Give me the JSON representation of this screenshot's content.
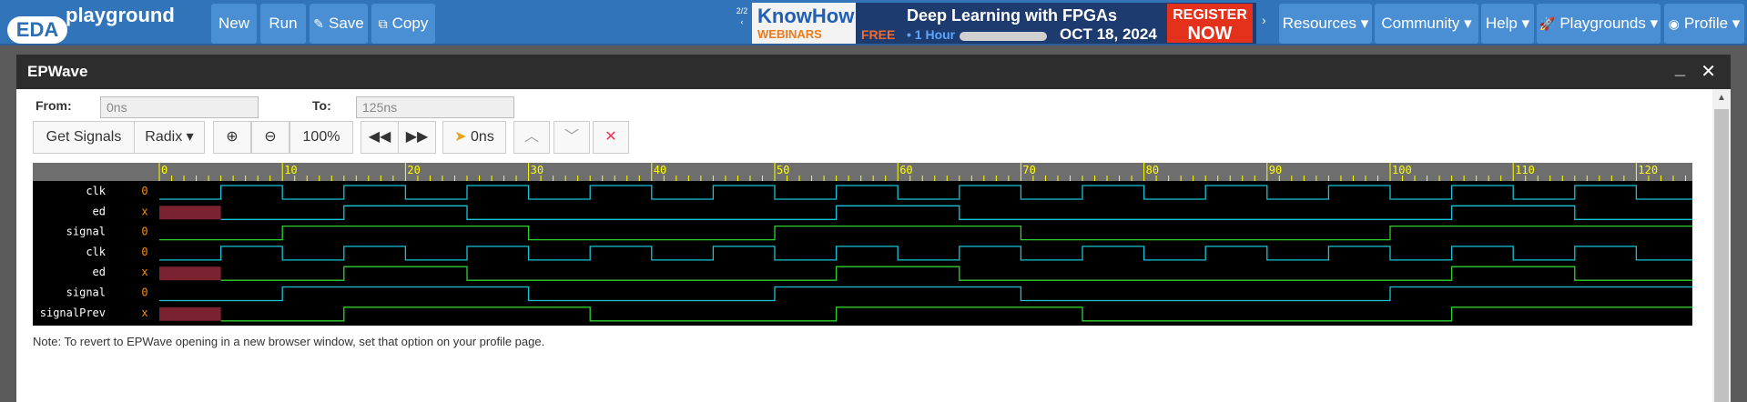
{
  "nav": {
    "logo_eda": "EDA",
    "logo_playground": "playground",
    "new": "New",
    "run": "Run",
    "save": "Save",
    "copy": "Copy",
    "pager": "2/2",
    "resources": "Resources",
    "community": "Community",
    "help": "Help",
    "playgrounds": "Playgrounds",
    "profile": "Profile"
  },
  "ad": {
    "brand": "KnowHow",
    "brand_sub": "WEBINARS",
    "title": "Deep Learning with FPGAs",
    "free": "FREE",
    "duration": "1 Hour",
    "date": "OCT 18, 2024",
    "register": "REGISTER",
    "now": "NOW"
  },
  "window": {
    "title": "EPWave"
  },
  "controls": {
    "from_label": "From:",
    "from_value": "0ns",
    "to_label": "To:",
    "to_value": "125ns",
    "get_signals": "Get Signals",
    "radix": "Radix",
    "zoom_level": "100%",
    "cursor_time": "0ns"
  },
  "waveform": {
    "ticks": [
      "0",
      "10",
      "20",
      "30",
      "40",
      "50",
      "60",
      "70",
      "80",
      "90",
      "100",
      "110",
      "120"
    ],
    "signals": [
      {
        "name": "clk",
        "value": "0"
      },
      {
        "name": "ed",
        "value": "x"
      },
      {
        "name": "signal",
        "value": "0"
      },
      {
        "name": "clk",
        "value": "0"
      },
      {
        "name": "ed",
        "value": "x"
      },
      {
        "name": "signal",
        "value": "0"
      },
      {
        "name": "signalPrev",
        "value": "x"
      }
    ]
  },
  "note": "Note: To revert to EPWave opening in a new browser window, set that option on your profile page.",
  "colors": {
    "nav": "#3274b9",
    "clock": "#17c3d6",
    "signal": "#2fd12f",
    "unknown": "#7a2230",
    "value_text": "#ff8c00",
    "tick": "#ffff00"
  }
}
